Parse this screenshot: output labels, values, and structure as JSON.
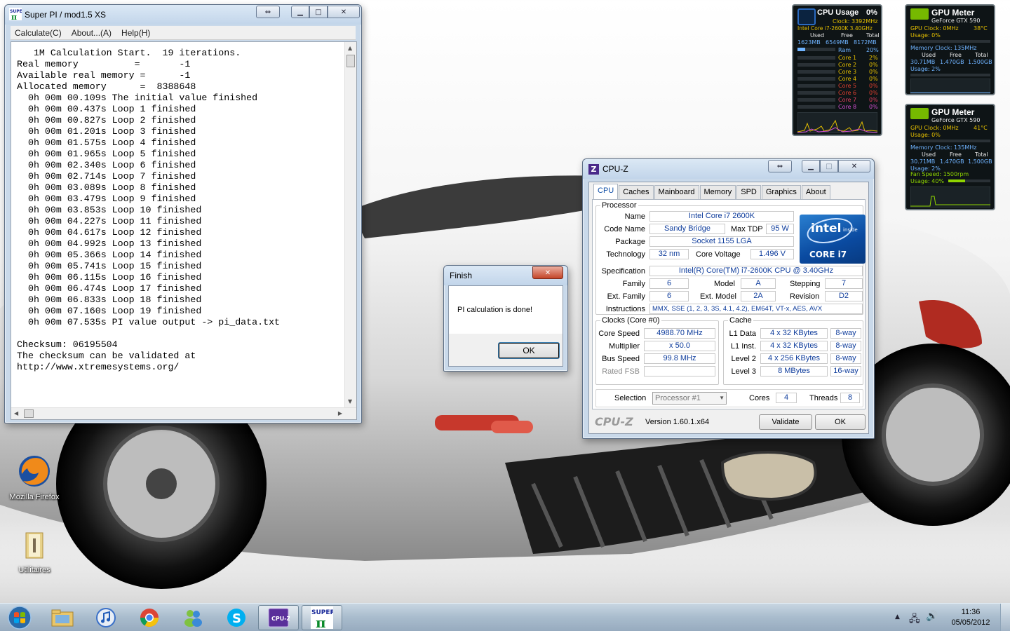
{
  "superpi": {
    "title": "Super PI / mod1.5 XS",
    "menu": [
      "Calculate(C)",
      "About...(A)",
      "Help(H)"
    ],
    "console": "   1M Calculation Start.  19 iterations.\nReal memory          =       -1\nAvailable real memory =      -1\nAllocated memory      =  8388648\n  0h 00m 00.109s The initial value finished\n  0h 00m 00.437s Loop 1 finished\n  0h 00m 00.827s Loop 2 finished\n  0h 00m 01.201s Loop 3 finished\n  0h 00m 01.575s Loop 4 finished\n  0h 00m 01.965s Loop 5 finished\n  0h 00m 02.340s Loop 6 finished\n  0h 00m 02.714s Loop 7 finished\n  0h 00m 03.089s Loop 8 finished\n  0h 00m 03.479s Loop 9 finished\n  0h 00m 03.853s Loop 10 finished\n  0h 00m 04.227s Loop 11 finished\n  0h 00m 04.617s Loop 12 finished\n  0h 00m 04.992s Loop 13 finished\n  0h 00m 05.366s Loop 14 finished\n  0h 00m 05.741s Loop 15 finished\n  0h 00m 06.115s Loop 16 finished\n  0h 00m 06.474s Loop 17 finished\n  0h 00m 06.833s Loop 18 finished\n  0h 00m 07.160s Loop 19 finished\n  0h 00m 07.535s PI value output -> pi_data.txt\n\nChecksum: 06195504\nThe checksum can be validated at\nhttp://www.xtremesystems.org/"
  },
  "finish": {
    "title": "Finish",
    "message": "PI calculation is done!",
    "ok": "OK"
  },
  "cpuz": {
    "title": "CPU-Z",
    "tabs": [
      "CPU",
      "Caches",
      "Mainboard",
      "Memory",
      "SPD",
      "Graphics",
      "About"
    ],
    "processor": {
      "group": "Processor",
      "name_label": "Name",
      "name": "Intel Core i7 2600K",
      "codename_label": "Code Name",
      "codename": "Sandy Bridge",
      "maxtdp_label": "Max TDP",
      "maxtdp": "95 W",
      "package_label": "Package",
      "package": "Socket 1155 LGA",
      "technology_label": "Technology",
      "technology": "32 nm",
      "corevoltage_label": "Core Voltage",
      "corevoltage": "1.496 V",
      "spec_label": "Specification",
      "spec": "Intel(R) Core(TM) i7-2600K CPU @ 3.40GHz",
      "family_label": "Family",
      "family": "6",
      "model_label": "Model",
      "model": "A",
      "stepping_label": "Stepping",
      "stepping": "7",
      "extfamily_label": "Ext. Family",
      "extfamily": "6",
      "extmodel_label": "Ext. Model",
      "extmodel": "2A",
      "revision_label": "Revision",
      "revision": "D2",
      "instructions_label": "Instructions",
      "instructions": "MMX, SSE (1, 2, 3, 3S, 4.1, 4.2), EM64T, VT-x, AES, AVX",
      "logo_brand": "intel",
      "logo_inside": "inside",
      "logo_model": "CORE i7"
    },
    "clocks": {
      "group": "Clocks (Core #0)",
      "corespeed_label": "Core Speed",
      "corespeed": "4988.70 MHz",
      "multiplier_label": "Multiplier",
      "multiplier": "x 50.0",
      "busspeed_label": "Bus Speed",
      "busspeed": "99.8 MHz",
      "ratedfsb_label": "Rated FSB",
      "ratedfsb": ""
    },
    "cache": {
      "group": "Cache",
      "l1d_label": "L1 Data",
      "l1d": "4 x 32 KBytes",
      "l1d_way": "8-way",
      "l1i_label": "L1 Inst.",
      "l1i": "4 x 32 KBytes",
      "l1i_way": "8-way",
      "l2_label": "Level 2",
      "l2": "4 x 256 KBytes",
      "l2_way": "8-way",
      "l3_label": "Level 3",
      "l3": "8 MBytes",
      "l3_way": "16-way"
    },
    "selection": {
      "label": "Selection",
      "value": "Processor #1",
      "cores_label": "Cores",
      "cores": "4",
      "threads_label": "Threads",
      "threads": "8"
    },
    "brand": "CPU-Z",
    "version": "Version 1.60.1.x64",
    "validate": "Validate",
    "ok": "OK"
  },
  "cpu_gadget": {
    "title": "CPU Usage",
    "usage": "0%",
    "clock": "Clock: 3392MHz",
    "model": "Intel Core i7-2600K 3.40GHz",
    "mem_headers": [
      "Used",
      "Free",
      "Total"
    ],
    "mem_values": [
      "1623MB",
      "6549MB",
      "8172MB"
    ],
    "ram_label": "Ram",
    "ram_pct": "20%",
    "cores": [
      {
        "label": "Core 1",
        "pct": "2%"
      },
      {
        "label": "Core 2",
        "pct": "0%"
      },
      {
        "label": "Core 3",
        "pct": "0%"
      },
      {
        "label": "Core 4",
        "pct": "0%"
      },
      {
        "label": "Core 5",
        "pct": "0%"
      },
      {
        "label": "Core 6",
        "pct": "0%"
      },
      {
        "label": "Core 7",
        "pct": "0%"
      },
      {
        "label": "Core 8",
        "pct": "0%"
      }
    ],
    "core_colors": [
      "#e6c000",
      "#e6c000",
      "#e6c000",
      "#e6c000",
      "#e04030",
      "#e04030",
      "#e04060",
      "#d050d0"
    ],
    "ram_fraction": 0.2
  },
  "gpu_gadget_1": {
    "title": "GPU Meter",
    "card": "GeForce GTX 590",
    "clock": "GPU Clock: 0MHz",
    "temp": "38°C",
    "usage": "Usage: 0%",
    "memclock": "Memory Clock: 135MHz",
    "mem_headers": [
      "Used",
      "Free",
      "Total"
    ],
    "mem_values": [
      "30.71MB",
      "1.470GB",
      "1.500GB"
    ],
    "mem_usage": "Usage: 2%"
  },
  "gpu_gadget_2": {
    "title": "GPU Meter",
    "card": "GeForce GTX 590",
    "clock": "GPU Clock: 0MHz",
    "temp": "41°C",
    "usage": "Usage: 0%",
    "memclock": "Memory Clock: 135MHz",
    "mem_headers": [
      "Used",
      "Free",
      "Total"
    ],
    "mem_values": [
      "30.71MB",
      "1.470GB",
      "1.500GB"
    ],
    "mem_usage": "Usage: 2%",
    "fan": "Fan Speed: 1500rpm",
    "fan_usage": "Usage: 40%",
    "fan_fraction": 0.4
  },
  "desktop": {
    "icons": [
      {
        "label": "Mozilla Firefox",
        "icon": "firefox-icon"
      },
      {
        "label": "Utilitaires",
        "icon": "folder-icon"
      }
    ]
  },
  "taskbar": {
    "buttons": [
      "start-orb-icon",
      "explorer-icon",
      "itunes-icon",
      "chrome-icon",
      "messenger-icon",
      "skype-icon",
      "cpuz-icon",
      "superpi-icon"
    ],
    "time": "11:36",
    "date": "05/05/2012"
  }
}
